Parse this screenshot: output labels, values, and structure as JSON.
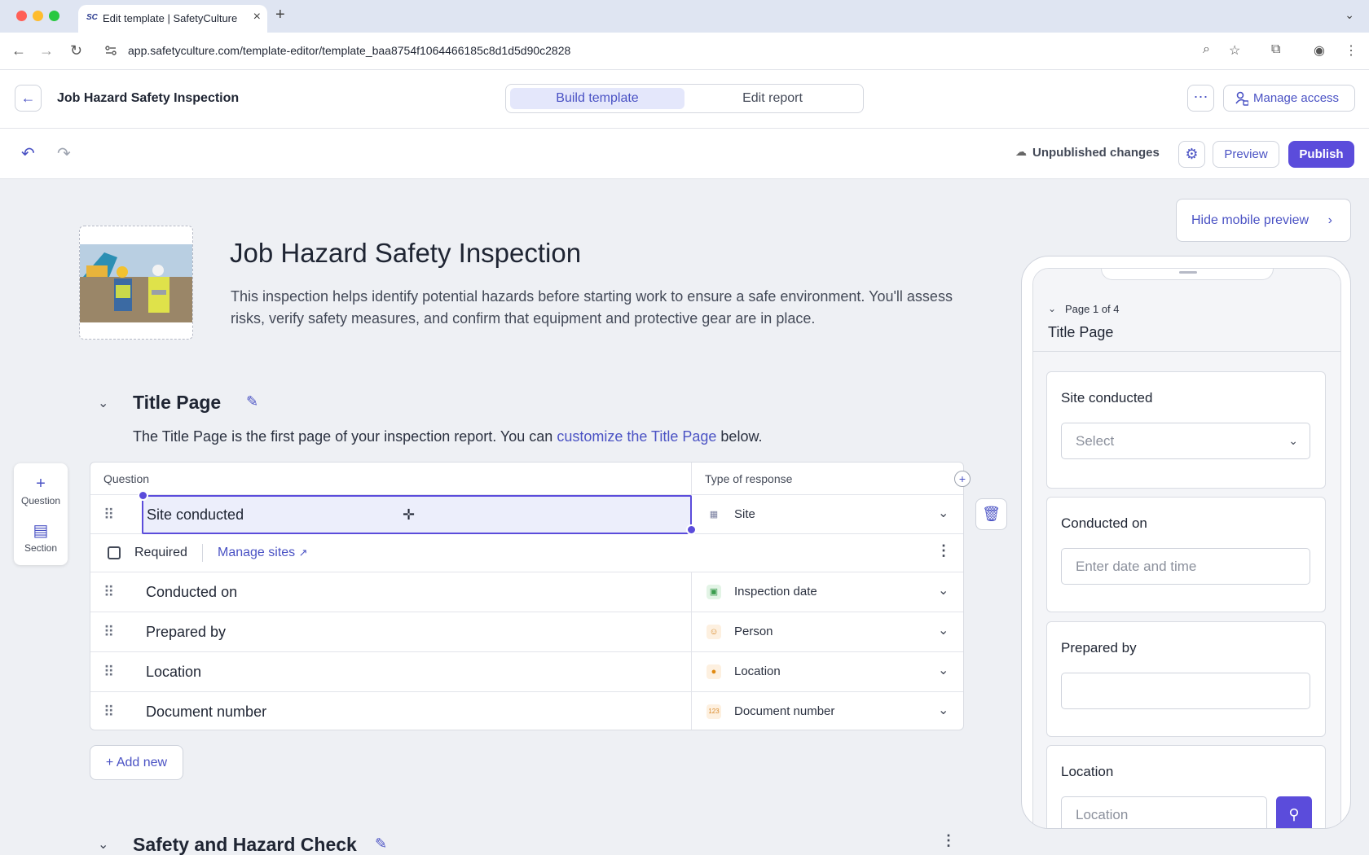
{
  "browser": {
    "tab_title": "Edit template | SafetyCulture",
    "tab_favicon": "SC",
    "url": "app.safetyculture.com/template-editor/template_baa8754f1064466185c8d1d5d90c2828"
  },
  "header": {
    "title": "Job Hazard Safety Inspection",
    "tabs": [
      {
        "label": "Build template",
        "active": true
      },
      {
        "label": "Edit report",
        "active": false
      }
    ],
    "manage_access_label": "Manage access"
  },
  "toolbar": {
    "status": "Unpublished changes",
    "preview_label": "Preview",
    "publish_label": "Publish"
  },
  "template": {
    "title": "Job Hazard Safety Inspection",
    "description": "This inspection helps identify potential hazards before starting work to ensure a safe environment. You'll assess risks, verify safety measures, and confirm that equipment and protective gear are in place."
  },
  "left_panel": {
    "question_label": "Question",
    "section_label": "Section"
  },
  "title_page": {
    "name": "Title Page",
    "desc_before": "The Title Page is the first page of your inspection report. You can ",
    "desc_link": "customize the Title Page",
    "desc_after": " below."
  },
  "table": {
    "col_question": "Question",
    "col_type": "Type of response",
    "selected_question": "Site conducted",
    "selected_type": "Site",
    "required_label": "Required",
    "manage_sites_label": "Manage sites",
    "rows": [
      {
        "question": "Conducted on",
        "type": "Inspection date"
      },
      {
        "question": "Prepared by",
        "type": "Person"
      },
      {
        "question": "Location",
        "type": "Location"
      },
      {
        "question": "Document number",
        "type": "Document number"
      }
    ]
  },
  "add_new_label": "Add new",
  "section2": {
    "name": "Safety and Hazard Check"
  },
  "mobile": {
    "hide_label": "Hide mobile preview",
    "page_indicator": "Page 1 of 4",
    "page_title": "Title Page",
    "cards": [
      {
        "label": "Site conducted",
        "placeholder": "Select"
      },
      {
        "label": "Conducted on",
        "placeholder": "Enter date and time"
      },
      {
        "label": "Prepared by",
        "placeholder": ""
      },
      {
        "label": "Location",
        "placeholder": "Location"
      }
    ]
  },
  "colors": {
    "accent": "#5b4cdb",
    "link": "#4a52c4"
  }
}
